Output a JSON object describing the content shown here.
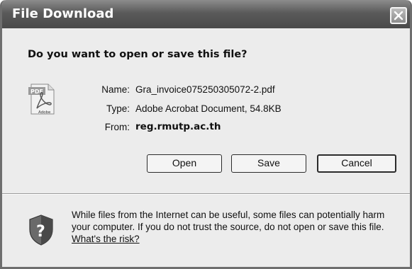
{
  "dialog": {
    "title": "File Download",
    "close_label": "close",
    "question": "Do you want to open or save this file?"
  },
  "file": {
    "icon": "pdf-file-icon",
    "icon_top_text": "PDF",
    "icon_bottom_text": "Adobe",
    "name_label": "Name:",
    "name_value": "Gra_invoice075250305072-2.pdf",
    "type_label": "Type:",
    "type_value": "Adobe Acrobat Document, 54.8KB",
    "from_label": "From:",
    "from_value": "reg.rmutp.ac.th"
  },
  "buttons": {
    "open": "Open",
    "save": "Save",
    "cancel": "Cancel"
  },
  "warning": {
    "icon": "shield-question-icon",
    "text": "While files from the Internet can be useful, some files can potentially harm your computer. If you do not trust the source, do not open or save this file.",
    "link": "What's the risk?"
  },
  "colors": {
    "titlebar": "#5a5a5a",
    "dialog_bg": "#ececec",
    "button_bg": "#f4f4f4"
  }
}
